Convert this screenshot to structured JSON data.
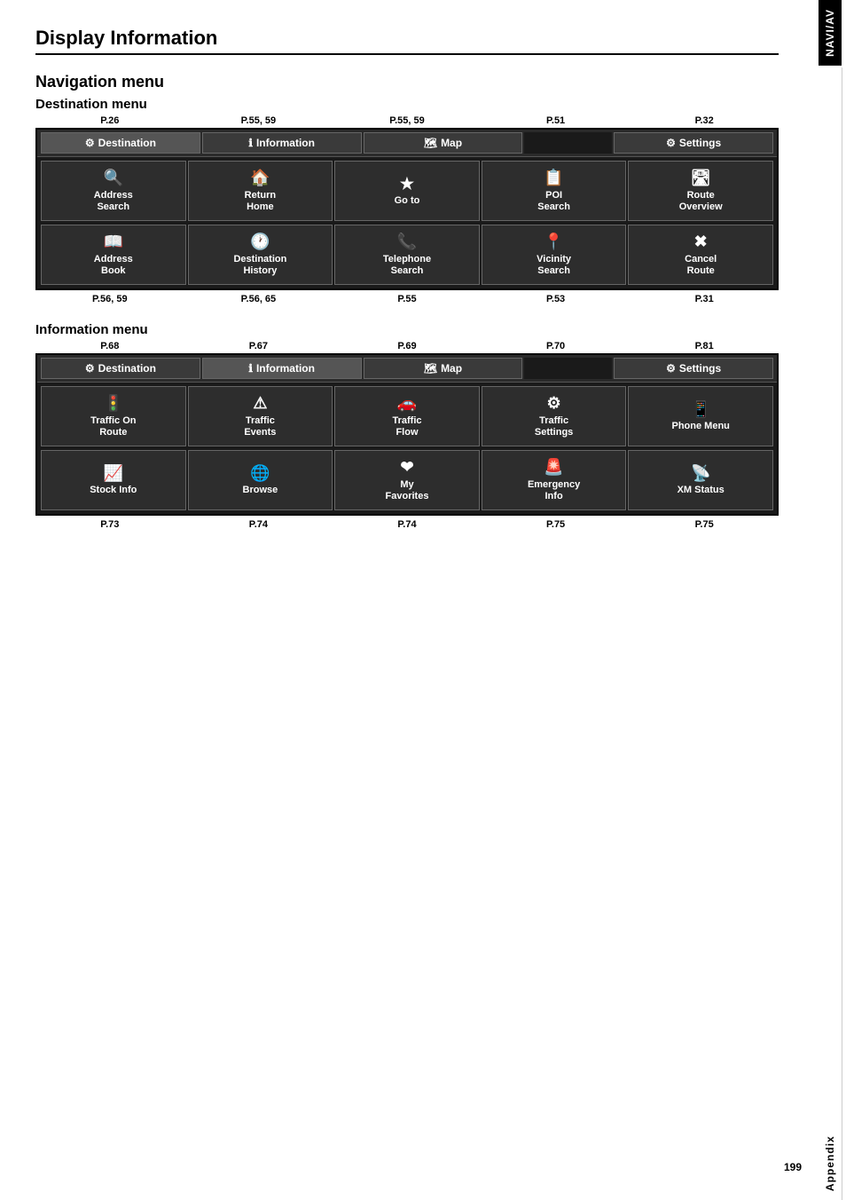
{
  "page": {
    "title": "Display Information",
    "page_number": "199"
  },
  "side_tabs": {
    "top": "NAVI/AV",
    "bottom": "Appendix"
  },
  "navigation_menu": {
    "title": "Navigation menu",
    "destination_menu": {
      "subtitle": "Destination menu",
      "top_page_nums": [
        "P.26",
        "P.55, 59",
        "P.55, 59",
        "P.51",
        "P.32"
      ],
      "bottom_page_nums": [
        "P.56, 59",
        "P.56, 65",
        "P.55",
        "P.53",
        "P.31"
      ],
      "menu_bar": [
        {
          "label": "Destination",
          "icon": "⚙"
        },
        {
          "label": "Information",
          "icon": "ℹ"
        },
        {
          "label": "Map",
          "icon": "🗺"
        },
        {
          "label": ""
        },
        {
          "label": "Settings",
          "icon": "⚙"
        }
      ],
      "grid_row1": [
        {
          "label": "Address\nSearch",
          "icon": "🔍"
        },
        {
          "label": "Return\nHome",
          "icon": "🏠"
        },
        {
          "label": "Go to",
          "icon": "★"
        },
        {
          "label": "POI\nSearch",
          "icon": "📋"
        },
        {
          "label": "Route\nOverview",
          "icon": "🛣"
        }
      ],
      "grid_row2": [
        {
          "label": "Address\nBook",
          "icon": "📖"
        },
        {
          "label": "Destination\nHistory",
          "icon": "🕐"
        },
        {
          "label": "Telephone\nSearch",
          "icon": "📞"
        },
        {
          "label": "Vicinity\nSearch",
          "icon": "📍"
        },
        {
          "label": "Cancel\nRoute",
          "icon": "✖"
        }
      ]
    },
    "information_menu": {
      "subtitle": "Information menu",
      "top_page_nums": [
        "P.68",
        "P.67",
        "P.69",
        "P.70",
        "P.81"
      ],
      "bottom_page_nums": [
        "P.73",
        "P.74",
        "P.74",
        "P.75",
        "P.75"
      ],
      "menu_bar": [
        {
          "label": "Destination",
          "icon": "⚙"
        },
        {
          "label": "Information",
          "icon": "ℹ"
        },
        {
          "label": "Map",
          "icon": "🗺"
        },
        {
          "label": ""
        },
        {
          "label": "Settings",
          "icon": "⚙"
        }
      ],
      "grid_row1": [
        {
          "label": "Traffic On\nRoute",
          "icon": "🚦"
        },
        {
          "label": "Traffic\nEvents",
          "icon": "⚠"
        },
        {
          "label": "Traffic\nFlow",
          "icon": "🚗"
        },
        {
          "label": "Traffic\nSettings",
          "icon": "⚙"
        },
        {
          "label": "Phone Menu",
          "icon": "📱"
        }
      ],
      "grid_row2": [
        {
          "label": "Stock Info",
          "icon": "📈"
        },
        {
          "label": "Browse",
          "icon": "🌐"
        },
        {
          "label": "My\nFavorites",
          "icon": "❤"
        },
        {
          "label": "Emergency\nInfo",
          "icon": "🚨"
        },
        {
          "label": "XM Status",
          "icon": "📡"
        }
      ]
    }
  }
}
